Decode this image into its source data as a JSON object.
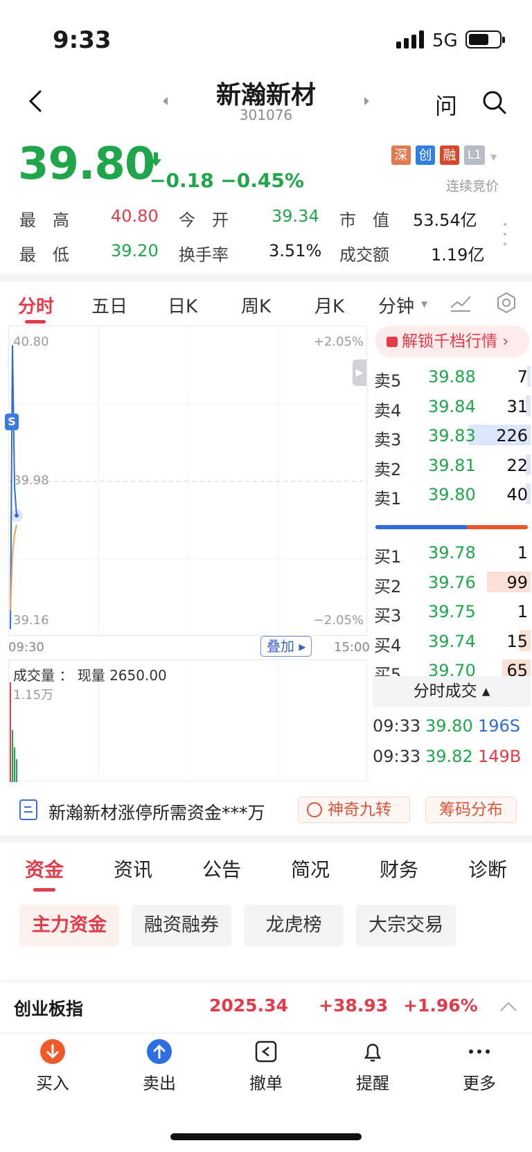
{
  "status_bar": {
    "time": "9:33",
    "network": "5G"
  },
  "header": {
    "stock_name": "新瀚新材",
    "stock_code": "301076",
    "ask_label": "问"
  },
  "quote": {
    "price": "39.80",
    "change": "−0.18",
    "change_pct": "−0.45%",
    "tags": [
      "深",
      "创",
      "融",
      "L1"
    ],
    "trade_status": "连续竞价"
  },
  "stats": [
    {
      "label": "最　高",
      "value": "40.80",
      "color": "#e23b4a"
    },
    {
      "label": "今　开",
      "value": "39.34",
      "color": "#1fa64a"
    },
    {
      "label": "市　值",
      "value": "53.54亿",
      "color": "#111111"
    },
    {
      "label": "最　低",
      "value": "39.20",
      "color": "#1fa64a"
    },
    {
      "label": "换手率",
      "value": "3.51%",
      "color": "#111111"
    },
    {
      "label": "成交额",
      "value": "1.19亿",
      "color": "#111111"
    }
  ],
  "chart_tabs": [
    "分时",
    "五日",
    "日K",
    "周K",
    "月K",
    "分钟"
  ],
  "chart": {
    "y_high": "40.80",
    "y_mid": "39.98",
    "y_low": "39.16",
    "pct_high": "+2.05%",
    "pct_low": "−2.05%",
    "time_start": "09:30",
    "time_end": "15:00",
    "overlay_btn": "叠加",
    "marker": "S",
    "volume_label": "成交量",
    "volume_now": "现量 2650.00",
    "volume_max": "1.15万"
  },
  "chart_data": {
    "type": "line",
    "x": [
      "09:30",
      "09:31",
      "09:32",
      "09:33"
    ],
    "series": [
      {
        "values": [
          39.2,
          40.7,
          39.95,
          39.8
        ],
        "color": "#2f6bd9"
      },
      {
        "values": [
          39.3,
          39.6,
          39.7,
          39.75
        ],
        "color": "#f0a050"
      }
    ],
    "ylim": [
      39.16,
      40.8
    ],
    "volumes": [
      11500,
      6000,
      4000,
      2650
    ]
  },
  "unlock_label": "解锁千档行情",
  "order_book": {
    "asks": [
      {
        "label": "卖5",
        "price": "39.88",
        "vol": "7",
        "bar": 0.02
      },
      {
        "label": "卖4",
        "price": "39.84",
        "vol": "31",
        "bar": 0.03
      },
      {
        "label": "卖3",
        "price": "39.83",
        "vol": "226",
        "bar": 0.4
      },
      {
        "label": "卖2",
        "price": "39.81",
        "vol": "22",
        "bar": 0.03
      },
      {
        "label": "卖1",
        "price": "39.80",
        "vol": "40",
        "bar": 0.03
      }
    ],
    "bids": [
      {
        "label": "买1",
        "price": "39.78",
        "vol": "1",
        "bar": 0.0
      },
      {
        "label": "买2",
        "price": "39.76",
        "vol": "99",
        "bar": 0.28
      },
      {
        "label": "买3",
        "price": "39.75",
        "vol": "1",
        "bar": 0.0
      },
      {
        "label": "买4",
        "price": "39.74",
        "vol": "15",
        "bar": 0.07
      },
      {
        "label": "买5",
        "price": "39.70",
        "vol": "65",
        "bar": 0.18
      }
    ],
    "buy_ratio": 0.6
  },
  "trades_header": "分时成交",
  "trades": [
    {
      "time": "09:33",
      "price": "39.80",
      "vol": "196S",
      "color": "#2f6bd9"
    },
    {
      "time": "09:33",
      "price": "39.82",
      "vol": "149B",
      "color": "#e23b4a"
    }
  ],
  "promo": {
    "text": "新瀚新材涨停所需资金***万",
    "btn1": "神奇九转",
    "btn2": "筹码分布"
  },
  "info_tabs": [
    "资金",
    "资讯",
    "公告",
    "简况",
    "财务",
    "诊断"
  ],
  "sub_tabs": [
    "主力资金",
    "融资融券",
    "龙虎榜",
    "大宗交易"
  ],
  "index_bar": {
    "name": "创业板指",
    "value": "2025.34",
    "change": "+38.93",
    "pct": "+1.96%"
  },
  "bottom_nav": [
    {
      "label": "买入",
      "icon": "buy-icon"
    },
    {
      "label": "卖出",
      "icon": "sell-icon"
    },
    {
      "label": "撤单",
      "icon": "cancel-order-icon"
    },
    {
      "label": "提醒",
      "icon": "bell-icon"
    },
    {
      "label": "更多",
      "icon": "more-icon"
    }
  ]
}
